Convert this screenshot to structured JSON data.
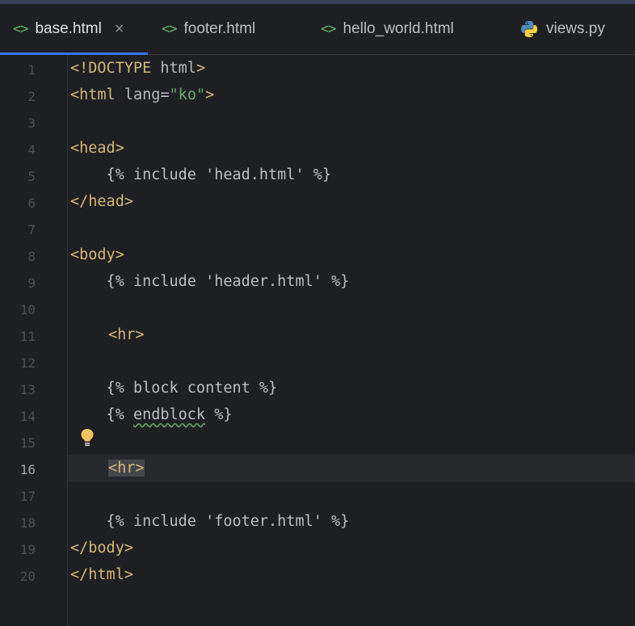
{
  "tabs": [
    {
      "label": "base.html",
      "icon": "html-file-icon",
      "active": true,
      "close": "×"
    },
    {
      "label": "footer.html",
      "icon": "html-file-icon"
    },
    {
      "label": "hello_world.html",
      "icon": "html-file-icon"
    },
    {
      "label": "views.py",
      "icon": "python-file-icon"
    }
  ],
  "tab_icon_glyph": "<>",
  "line_numbers": [
    "1",
    "2",
    "3",
    "4",
    "5",
    "6",
    "7",
    "8",
    "9",
    "10",
    "11",
    "12",
    "13",
    "14",
    "15",
    "16",
    "17",
    "18",
    "19",
    "20"
  ],
  "current_line": "16",
  "code": {
    "l1_tag": "<!DOCTYPE",
    "l1_rest": " html",
    "l1_end": ">",
    "l2_tag": "<html",
    "l2_attr": " lang",
    "l2_eq": "=",
    "l2_str": "\"ko\"",
    "l2_end": ">",
    "l4": "<head>",
    "l5": "    {% include 'head.html' %}",
    "l6": "</head>",
    "l8": "<body>",
    "l9": "    {% include 'header.html' %}",
    "l11": "<hr>",
    "l13": "    {% block content %}",
    "l14_pre": "    {% ",
    "l14_kw": "endblock",
    "l14_post": " %}",
    "l16": "<hr>",
    "l18": "    {% include 'footer.html' %}",
    "l19": "</body>",
    "l20": "</html>"
  },
  "colors": {
    "accent": "#3574f0",
    "tag": "#d5b778",
    "string": "#6aab73",
    "bulb": "#f2c55c"
  }
}
